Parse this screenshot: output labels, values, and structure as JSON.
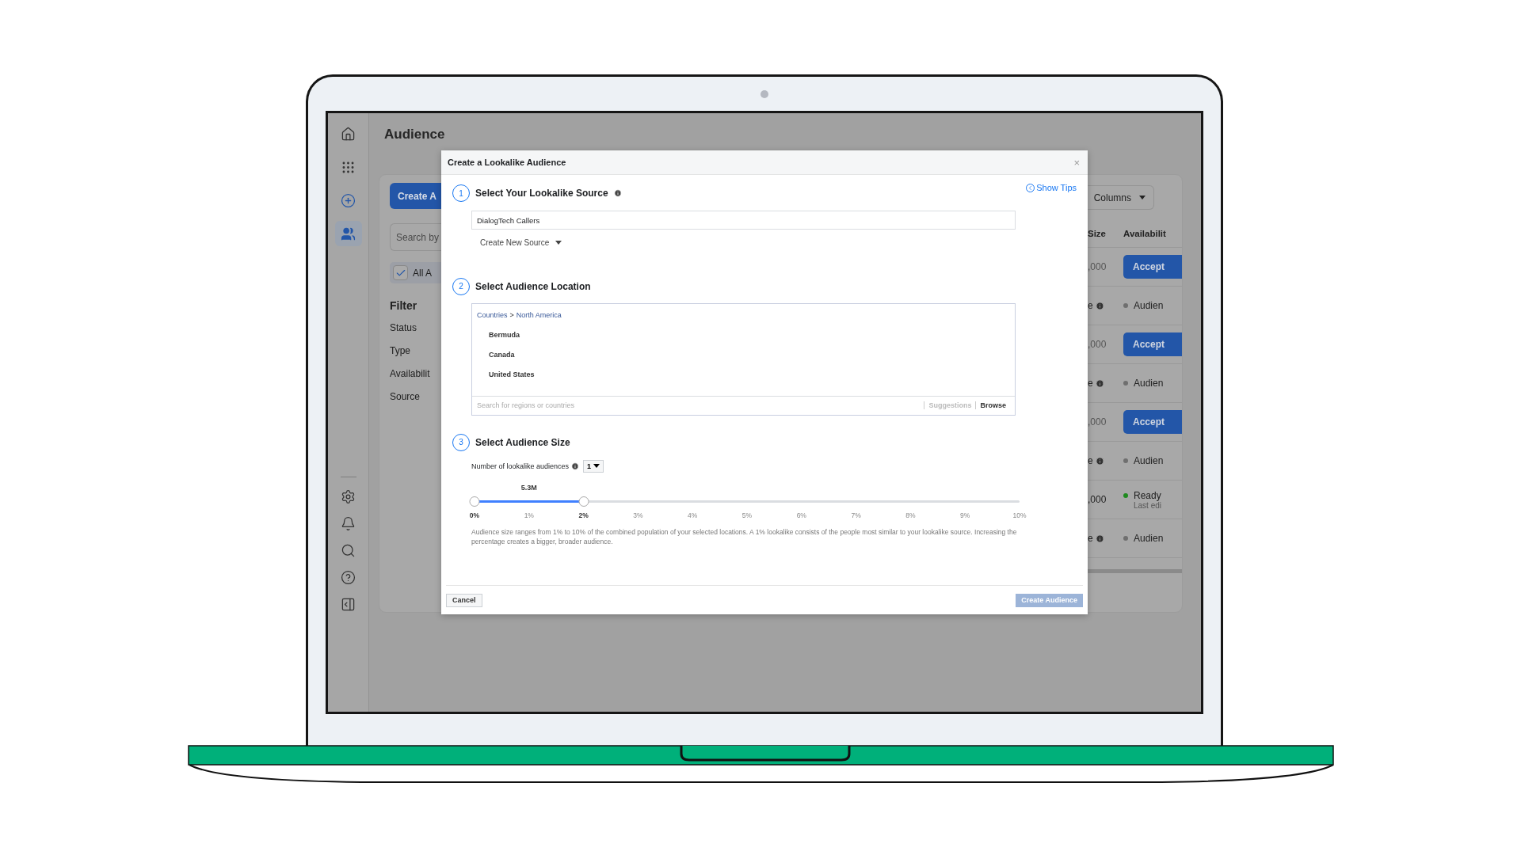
{
  "sidebar": {
    "items": [
      {
        "kind": "home",
        "selected": false
      },
      {
        "kind": "apps",
        "selected": false
      },
      {
        "kind": "create",
        "selected": false
      },
      {
        "kind": "audiences",
        "selected": true
      }
    ],
    "bottom_items": [
      {
        "kind": "settings",
        "selected": false
      },
      {
        "kind": "notifications",
        "selected": false
      },
      {
        "kind": "search",
        "selected": false
      },
      {
        "kind": "help",
        "selected": false
      },
      {
        "kind": "panel",
        "selected": false
      }
    ]
  },
  "page": {
    "title": "Audience"
  },
  "toolbar": {
    "create_button": "Create A",
    "search_placeholder": "Search by"
  },
  "select_all": {
    "label": "All A",
    "checked": true
  },
  "filter": {
    "title": "Filter",
    "items": [
      "Status",
      "Type",
      "Availabilit",
      "Source"
    ]
  },
  "table": {
    "columns_button": "Columns",
    "columns": [
      "Size",
      "Availabilit"
    ],
    "rows": [
      {
        "kind": "action",
        "size": ",000",
        "button": "Accept"
      },
      {
        "kind": "status",
        "size": "e",
        "info": true,
        "availability": "Audien",
        "color": "#6f6f6f"
      },
      {
        "kind": "action",
        "size": ",000",
        "button": "Accept"
      },
      {
        "kind": "status",
        "size": "e",
        "info": true,
        "availability": "Audien",
        "color": "#6f6f6f"
      },
      {
        "kind": "action",
        "size": ",000",
        "button": "Accept"
      },
      {
        "kind": "status",
        "size": "e",
        "info": true,
        "availability": "Audien",
        "color": "#6f6f6f"
      },
      {
        "kind": "status",
        "size": ",000",
        "info": false,
        "availability": "Ready",
        "note": "Last edi",
        "color": "#1f8a1f"
      },
      {
        "kind": "status",
        "size": "e",
        "info": true,
        "availability": "Audien",
        "color": "#6f6f6f"
      }
    ]
  },
  "dialog": {
    "title": "Create a Lookalike Audience",
    "close": "×",
    "show_tips": "Show Tips",
    "source_step": {
      "number": "1",
      "title": "Select Your Lookalike Source",
      "value": "DialogTech Callers",
      "create_new": "Create New Source"
    },
    "location_step": {
      "number": "2",
      "title": "Select Audience Location",
      "breadcrumb": [
        "Countries",
        "North America"
      ],
      "separator": ">",
      "locations": [
        "Bermuda",
        "Canada",
        "United States"
      ],
      "search_placeholder": "Search for regions or countries",
      "tabs": [
        {
          "label": "Suggestions",
          "selected": false
        },
        {
          "label": "Browse",
          "selected": true
        }
      ]
    },
    "size_step": {
      "number": "3",
      "title": "Select Audience Size",
      "count_label": "Number of lookalike audiences",
      "count_value": "1",
      "range_label": "5.3M",
      "level": 0.2,
      "ticks": [
        {
          "label": "0%",
          "selected": true
        },
        {
          "label": "1%",
          "selected": false
        },
        {
          "label": "2%",
          "selected": true
        },
        {
          "label": "3%",
          "selected": false
        },
        {
          "label": "4%",
          "selected": false
        },
        {
          "label": "5%",
          "selected": false
        },
        {
          "label": "6%",
          "selected": false
        },
        {
          "label": "7%",
          "selected": false
        },
        {
          "label": "8%",
          "selected": false
        },
        {
          "label": "9%",
          "selected": false
        },
        {
          "label": "10%",
          "selected": false
        }
      ],
      "description": "Audience size ranges from 1% to 10% of the combined population of your selected locations. A 1% lookalike consists of the people most similar to your lookalike source. Increasing the percentage creates a bigger, broader audience."
    },
    "cancel": "Cancel",
    "create": {
      "label": "Create Audience",
      "disabled": true
    }
  }
}
